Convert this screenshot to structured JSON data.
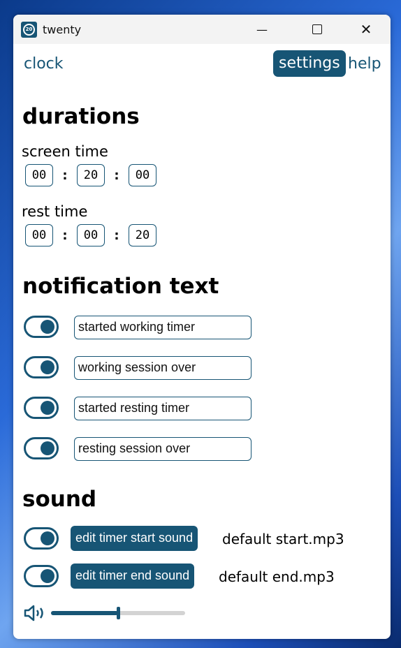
{
  "window": {
    "title": "twenty",
    "icon": "alarm-clock-20-icon",
    "accent": "#175575"
  },
  "nav": {
    "clock": "clock",
    "settings": "settings",
    "help": "help",
    "active": "settings"
  },
  "durations": {
    "heading": "durations",
    "screen_time": {
      "label": "screen time",
      "hours": "00",
      "minutes": "20",
      "seconds": "00"
    },
    "rest_time": {
      "label": "rest time",
      "hours": "00",
      "minutes": "00",
      "seconds": "20"
    },
    "separator": ":"
  },
  "notifications": {
    "heading": "notification text",
    "items": [
      {
        "enabled": true,
        "text": "started working timer"
      },
      {
        "enabled": true,
        "text": "working session over"
      },
      {
        "enabled": true,
        "text": "started resting timer"
      },
      {
        "enabled": true,
        "text": "resting session over"
      }
    ]
  },
  "sound": {
    "heading": "sound",
    "start": {
      "enabled": true,
      "button": "edit timer start sound",
      "file": "default start.mp3"
    },
    "end": {
      "enabled": true,
      "button": "edit timer end sound",
      "file": "default end.mp3"
    },
    "volume_percent": 50
  }
}
